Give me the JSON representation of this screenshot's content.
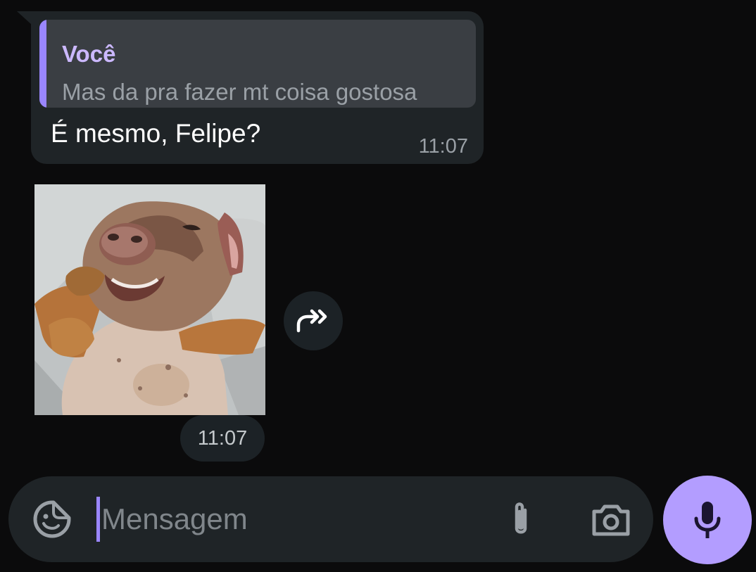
{
  "chat": {
    "reply_message": {
      "quoted_author": "Você",
      "quoted_text": "Mas da pra fazer mt coisa gostosa",
      "text": "É mesmo, Felipe?",
      "time": "11:07"
    },
    "sticker_message": {
      "time": "11:07",
      "sticker_icon": "dachshund-sticker-icon",
      "forward_icon": "forward-icon"
    }
  },
  "composer": {
    "placeholder": "Mensagem",
    "emoji_icon": "sticker-emoji-icon",
    "attach_icon": "paperclip-icon",
    "camera_icon": "camera-icon",
    "mic_icon": "microphone-icon"
  },
  "colors": {
    "background": "#0b0b0c",
    "bubble": "#1f2427",
    "quote_bg": "#3a3e43",
    "accent": "#9a86ff",
    "mic_button": "#b39dff"
  }
}
